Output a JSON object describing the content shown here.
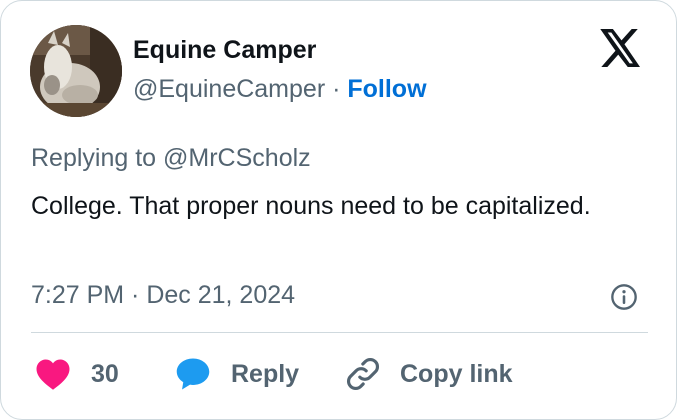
{
  "author": {
    "name": "Equine Camper",
    "handle": "@EquineCamper",
    "separator": "·",
    "follow_label": "Follow"
  },
  "tweet": {
    "replying_prefix": "Replying to ",
    "replying_to": "@MrCScholz",
    "text": "College. That proper nouns need to be capitalized.",
    "timestamp": "7:27 PM · Dec 21, 2024"
  },
  "actions": {
    "like_count": "30",
    "reply_label": "Reply",
    "copy_link_label": "Copy link"
  },
  "icons": {
    "logo": "x-logo-icon",
    "info": "info-icon",
    "like": "heart-icon",
    "reply": "speech-bubble-icon",
    "copy": "link-icon"
  },
  "colors": {
    "like": "#f91880",
    "reply": "#1d9bf0",
    "follow": "#006fd6",
    "secondary_text": "#536471",
    "primary_text": "#0f1419"
  }
}
